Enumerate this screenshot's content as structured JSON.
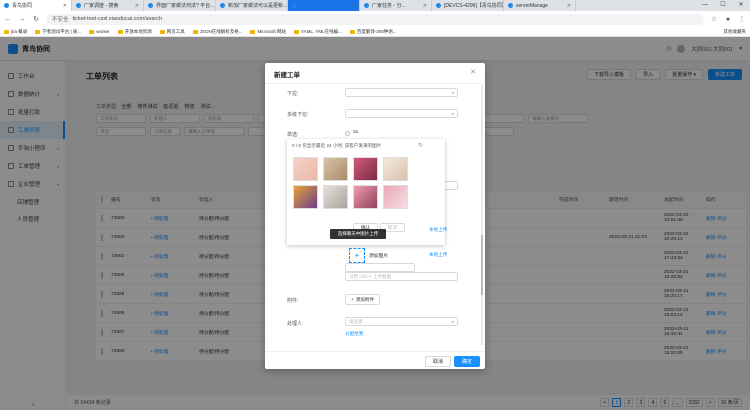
{
  "browser": {
    "tabs": [
      {
        "label": "青鸟协同",
        "active": true
      },
      {
        "label": "厂家调度 - 搜索"
      },
      {
        "label": "界面厂家做法何法? 平台..."
      },
      {
        "label": "新加厂家做法可以是更新..."
      },
      {
        "label": "",
        "accent": true
      },
      {
        "label": "厂家任务 - 分..."
      },
      {
        "label": "[DEVCS-4296]【青鸟协同】..."
      },
      {
        "label": "serverManage"
      }
    ],
    "url": "ticket-test-cxxl.xiaoducai.com/search",
    "security_label": "不安全",
    "bookmarks": [
      "jira 概录",
      "学者测试平台 | 质...",
      "worker",
      "开放本地资源",
      "网页工具",
      "JSON在线解析及格...",
      "Microsoft 网站",
      "YAML, YML在线编...",
      "百度翻译-200种语..."
    ],
    "other_bookmarks": "其他收藏夹"
  },
  "app": {
    "logo_text": "青鸟协同",
    "user": "大同001 大同001"
  },
  "sidebar": {
    "items": [
      {
        "label": "工作台"
      },
      {
        "label": "数据统计",
        "chevron": true
      },
      {
        "label": "批量打款"
      },
      {
        "label": "工单列表",
        "active": true
      },
      {
        "label": "手淘小程序",
        "chevron": true
      },
      {
        "label": "工单管理",
        "chevron": true
      },
      {
        "label": "企业管理",
        "chevron": true
      },
      {
        "label": "店铺管理",
        "sub": true
      },
      {
        "label": "人员管理",
        "sub": true
      }
    ],
    "footer": "≡"
  },
  "page": {
    "title": "工单列表",
    "top_buttons": [
      "下载导入模板",
      "导入",
      "批量操作 ▾",
      "新建工单"
    ],
    "type_label": "工单类型:",
    "type_tabs": [
      "全部",
      "修件测试",
      "延迟退",
      "物流",
      "测试..."
    ],
    "filters_row1": [
      "工单状态",
      "处理人",
      "优先级",
      "",
      "",
      "",
      "",
      "",
      "请输入关键词"
    ],
    "filters_row2": [
      "平台",
      "订单信息",
      "请输入订单号",
      "",
      "",
      "",
      "评分分数",
      "评分状态"
    ],
    "table": {
      "headers": [
        "",
        "编号",
        "状态",
        "处理人",
        "",
        "完成时间",
        "期望时间",
        "发起时间",
        "操作"
      ],
      "rows": [
        {
          "id": "73603",
          "status": "• 待处理",
          "handler": "待分配/待分配",
          "expected": "",
          "created": "2022-03-22 10:51:48",
          "ops": "删除 评分"
        },
        {
          "id": "73602",
          "status": "• 待处理",
          "handler": "待分配/待分配",
          "expected": "2022-03-21 21:03",
          "created": "2022-03-22 10:20:13",
          "ops": "删除 评分"
        },
        {
          "id": "73601",
          "status": "• 待处理",
          "handler": "待分配/待分配",
          "expected": "",
          "created": "2022-03-21 17:43:34",
          "ops": "删除 评分"
        },
        {
          "id": "73600",
          "status": "• 待处理",
          "handler": "待分配/待分配",
          "expected": "",
          "created": "2022-03-21 16:25:52",
          "ops": "删除 评分"
        },
        {
          "id": "73599",
          "status": "• 待处理",
          "handler": "待分配/待分配",
          "expected": "",
          "created": "2022-03-21 16:20:17",
          "ops": "删除 评分"
        },
        {
          "id": "73598",
          "status": "• 待处理",
          "handler": "待分配/待分配",
          "expected": "",
          "created": "2022-03-21 16:04:14",
          "ops": "删除 评分"
        },
        {
          "id": "73597",
          "status": "• 待处理",
          "handler": "待分配/待分配",
          "expected": "",
          "created": "2022-03-21 15:32:31",
          "ops": "删除 评分"
        },
        {
          "id": "73596",
          "status": "• 待处理",
          "handler": "待分配/待分配",
          "expected": "",
          "created": "2022-03-21 15:20:05",
          "ops": "删除 评分"
        }
      ]
    },
    "pager": {
      "total": "共 64434 条记录",
      "pages": [
        "<",
        "1",
        "2",
        "3",
        "4",
        "5",
        "...",
        "2282",
        ">"
      ],
      "size": "10 条/页"
    }
  },
  "modal": {
    "title": "新建工单",
    "labels": {
      "dropdown": "下拉:",
      "multi": "多级下拉:",
      "single": "单选:",
      "attachment": "附件:",
      "handler": "处理人:"
    },
    "placeholders": {
      "select": "",
      "handler": "请选择"
    },
    "radio_value": "31",
    "popover_hint": "0 / 5 仅显示最近 24 小时, 该客户发来的图片",
    "confirm_small": "确认",
    "cancel_small": "取消",
    "tooltip": "选择聊天中图片上传",
    "add_image": "添加图片",
    "local_upload": "本地上传",
    "paste_hint": "可用 Ctrl+V 上传截图",
    "add_attachment": "添加附件",
    "assign_link": "分配给我",
    "cancel": "取消",
    "ok": "确定"
  }
}
